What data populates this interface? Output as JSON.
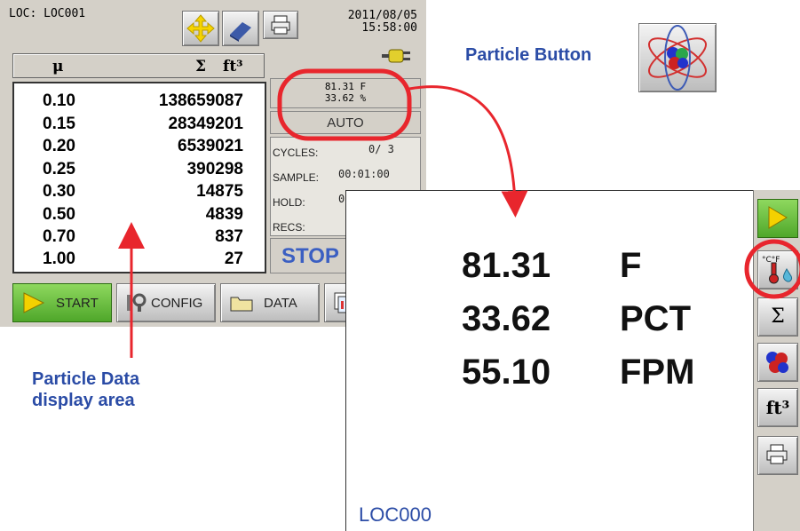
{
  "device": {
    "location_label": "LOC: LOC001",
    "date": "2011/08/05",
    "time": "15:58:00",
    "table": {
      "headers": {
        "size": "μ",
        "sum": "Σ",
        "unit": "ft³"
      },
      "rows": [
        {
          "size": "0.10",
          "count": "138659087"
        },
        {
          "size": "0.15",
          "count": "28349201"
        },
        {
          "size": "0.20",
          "count": "6539021"
        },
        {
          "size": "0.25",
          "count": "390298"
        },
        {
          "size": "0.30",
          "count": "14875"
        },
        {
          "size": "0.50",
          "count": "4839"
        },
        {
          "size": "0.70",
          "count": "837"
        },
        {
          "size": "1.00",
          "count": "27"
        }
      ]
    },
    "env_temp": "81.31  F",
    "env_humidity": "33.62 %",
    "mode": "AUTO",
    "cycles_label": "CYCLES:",
    "cycles_value": "0/   3",
    "sample_label": "SAMPLE:",
    "sample_value": "00:01:00",
    "hold_label": "HOLD:",
    "hold_value": "0",
    "recs_label": "RECS:",
    "status": "STOP",
    "buttons": {
      "start": "START",
      "config": "CONFIG",
      "data": "DATA"
    }
  },
  "zoom": {
    "rows": [
      {
        "value": "81.31",
        "unit": "F"
      },
      {
        "value": "33.62",
        "unit": "PCT"
      },
      {
        "value": "55.10",
        "unit": "FPM"
      }
    ],
    "location": "LOC000",
    "side_buttons": {
      "sigma": "Σ",
      "ft3": "ft³",
      "temp_icon_text": "°C°F"
    }
  },
  "annotations": {
    "particle_button": "Particle Button",
    "particle_data_line1": "Particle Data",
    "particle_data_line2": "display area"
  },
  "colors": {
    "annotation_blue": "#2b4ca6",
    "highlight_red": "#e8262d",
    "start_green": "#6cc33a",
    "status_blue": "#3b5fc2"
  }
}
